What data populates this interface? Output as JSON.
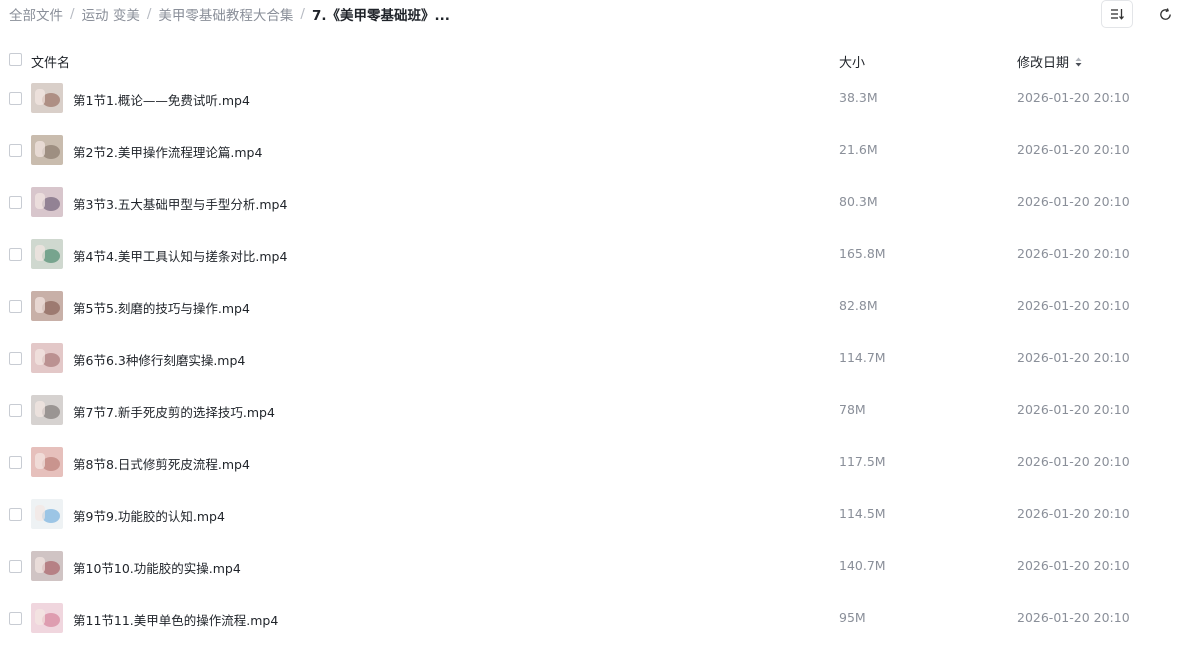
{
  "breadcrumb": {
    "items": [
      "全部文件",
      "运动 变美",
      "美甲零基础教程大合集"
    ],
    "current": "7.《美甲零基础班》...",
    "separator": "/"
  },
  "toolbar": {
    "sort_icon": "sort-list-icon",
    "refresh_icon": "refresh-icon"
  },
  "columns": {
    "name": "文件名",
    "size": "大小",
    "date": "修改日期"
  },
  "files": [
    {
      "name": "第1节1.概论——免费试听.mp4",
      "size": "38.3M",
      "date": "2026-01-20 20:10",
      "thumb_bg": "#d9cfc9",
      "thumb_fg": "#8a5b4a"
    },
    {
      "name": "第2节2.美甲操作流程理论篇.mp4",
      "size": "21.6M",
      "date": "2026-01-20 20:10",
      "thumb_bg": "#c9bcae",
      "thumb_fg": "#7a6a5c"
    },
    {
      "name": "第3节3.五大基础甲型与手型分析.mp4",
      "size": "80.3M",
      "date": "2026-01-20 20:10",
      "thumb_bg": "#d8c6cc",
      "thumb_fg": "#5a4a66"
    },
    {
      "name": "第4节4.美甲工具认知与搓条对比.mp4",
      "size": "165.8M",
      "date": "2026-01-20 20:10",
      "thumb_bg": "#cfd8cf",
      "thumb_fg": "#2f7a5a"
    },
    {
      "name": "第5节5.刻磨的技巧与操作.mp4",
      "size": "82.8M",
      "date": "2026-01-20 20:10",
      "thumb_bg": "#c8b0a8",
      "thumb_fg": "#7a4e44"
    },
    {
      "name": "第6节6.3种修行刻磨实操.mp4",
      "size": "114.7M",
      "date": "2026-01-20 20:10",
      "thumb_bg": "#e3c8c8",
      "thumb_fg": "#9a6464"
    },
    {
      "name": "第7节7.新手死皮剪的选择技巧.mp4",
      "size": "78M",
      "date": "2026-01-20 20:10",
      "thumb_bg": "#d6d2d0",
      "thumb_fg": "#6a6260"
    },
    {
      "name": "第8节8.日式修剪死皮流程.mp4",
      "size": "117.5M",
      "date": "2026-01-20 20:10",
      "thumb_bg": "#e6c0bc",
      "thumb_fg": "#b07068"
    },
    {
      "name": "第9节9.功能胶的认知.mp4",
      "size": "114.5M",
      "date": "2026-01-20 20:10",
      "thumb_bg": "#eef2f4",
      "thumb_fg": "#5aa0d8"
    },
    {
      "name": "第10节10.功能胶的实操.mp4",
      "size": "140.7M",
      "date": "2026-01-20 20:10",
      "thumb_bg": "#d0c4c4",
      "thumb_fg": "#a04a52"
    },
    {
      "name": "第11节11.美甲单色的操作流程.mp4",
      "size": "95M",
      "date": "2026-01-20 20:10",
      "thumb_bg": "#f0d6de",
      "thumb_fg": "#d0708a"
    }
  ]
}
